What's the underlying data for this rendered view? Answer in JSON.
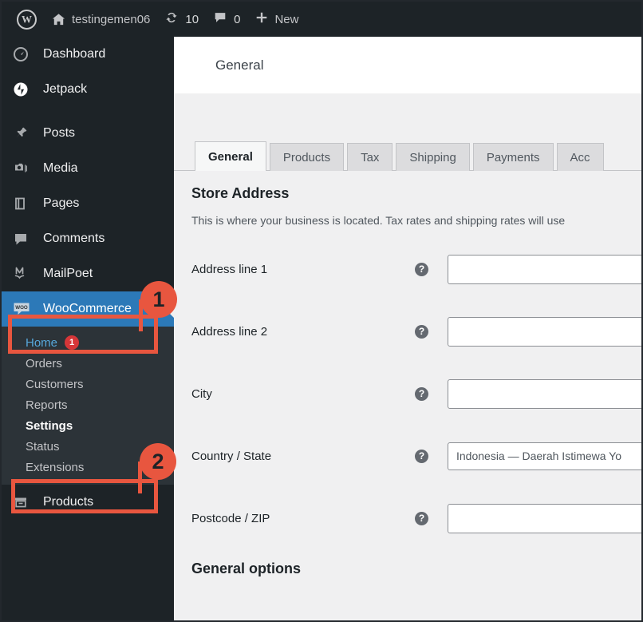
{
  "adminbar": {
    "logo_icon": "wordpress-logo-icon",
    "home_icon": "house-icon",
    "site_name": "testingemen06",
    "updates_icon": "updates-icon",
    "updates_count": "10",
    "comments_icon": "comment-bubble-icon",
    "comments_count": "0",
    "new_icon": "plus-icon",
    "new_label": "New"
  },
  "sidebar": {
    "items": [
      {
        "label": "Dashboard",
        "icon": "dashboard-gauge-icon"
      },
      {
        "label": "Jetpack",
        "icon": "jetpack-bolt-icon"
      },
      {
        "label": "Posts",
        "icon": "pin-icon"
      },
      {
        "label": "Media",
        "icon": "media-camera-icon"
      },
      {
        "label": "Pages",
        "icon": "pages-icon"
      },
      {
        "label": "Comments",
        "icon": "comment-bubble-icon"
      },
      {
        "label": "MailPoet",
        "icon": "mailpoet-icon"
      },
      {
        "label": "WooCommerce",
        "icon": "woocommerce-icon"
      },
      {
        "label": "Products",
        "icon": "products-box-icon"
      }
    ],
    "submenu": [
      {
        "label": "Home",
        "badge": "1"
      },
      {
        "label": "Orders",
        "badge": ""
      },
      {
        "label": "Customers",
        "badge": ""
      },
      {
        "label": "Reports",
        "badge": ""
      },
      {
        "label": "Settings",
        "badge": ""
      },
      {
        "label": "Status",
        "badge": ""
      },
      {
        "label": "Extensions",
        "badge": ""
      }
    ]
  },
  "content": {
    "header_title": "General",
    "tabs": [
      {
        "label": "General"
      },
      {
        "label": "Products"
      },
      {
        "label": "Tax"
      },
      {
        "label": "Shipping"
      },
      {
        "label": "Payments"
      },
      {
        "label": "Acc"
      }
    ],
    "store_address": {
      "title": "Store Address",
      "description": "This is where your business is located. Tax rates and shipping rates will use",
      "help_icon": "help-question-icon",
      "fields": [
        {
          "label": "Address line 1",
          "value": ""
        },
        {
          "label": "Address line 2",
          "value": ""
        },
        {
          "label": "City",
          "value": ""
        },
        {
          "label": "Country / State",
          "value": "Indonesia — Daerah Istimewa Yo"
        },
        {
          "label": "Postcode / ZIP",
          "value": ""
        }
      ]
    },
    "general_options_title": "General options"
  },
  "annotations": {
    "badge_one": "1",
    "badge_two": "2",
    "accent_color": "#e8563f"
  },
  "colors": {
    "admin_bar_bg": "#1d2327",
    "sidebar_bg": "#1d2327",
    "submenu_bg": "#2c3338",
    "current_menu_blue": "#2c79b8",
    "content_bg": "#f0f0f1",
    "badge_red": "#d63638",
    "annotation_orange": "#e8563f"
  }
}
